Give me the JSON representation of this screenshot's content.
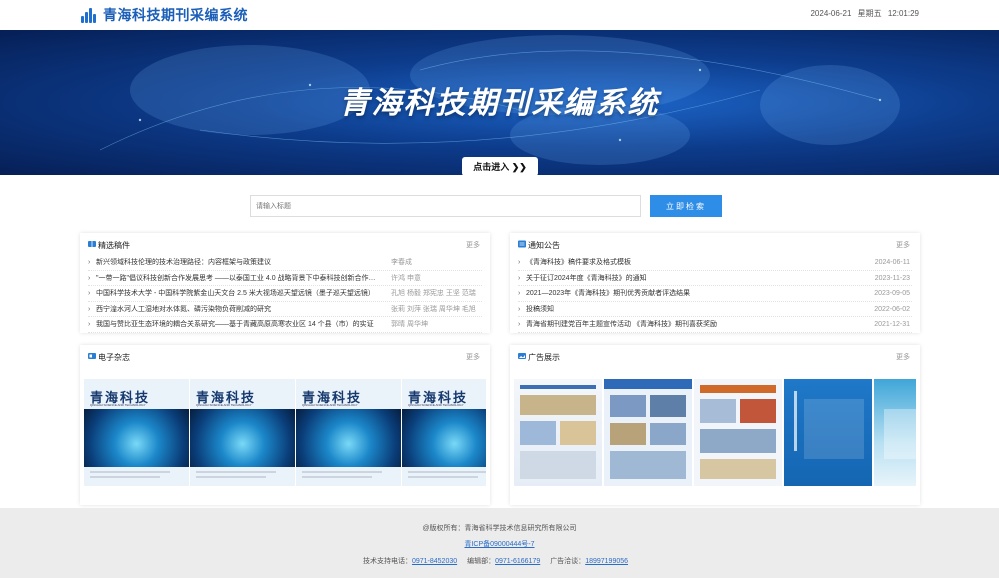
{
  "header": {
    "logo_text": "青海科技期刊采编系统",
    "date": "2024-06-21",
    "weekday": "星期五",
    "time": "12:01:29"
  },
  "banner": {
    "title": "青海科技期刊采编系统",
    "enter_label": "点击进入 ❯❯"
  },
  "search": {
    "placeholder": "请输入标题",
    "button_label": "立即检索"
  },
  "featured": {
    "title": "精选稿件",
    "more": "更多",
    "items": [
      {
        "title": "新兴领域科技伦理的技术治理路径：内容框架与政策建议",
        "authors": "李春成"
      },
      {
        "title": "\"一带一路\"倡议科技创新合作发展思考 ——以泰国工业 4.0 战略背景下中泰科技创新合作为例",
        "authors": "许鸿 申意"
      },
      {
        "title": "中国科学技术大学 - 中国科学院紫金山天文台 2.5 米大视场巡天望远镜（墨子巡天望远镜）",
        "authors": "孔旭 杨毅 郑宪忠 王坚 范瑞"
      },
      {
        "title": "西宁湟水河人工湿地对水体氮、磷污染物负荷削减的研究",
        "authors": "张莉 刘萍 张瑞 周华坤 毛旭"
      },
      {
        "title": "我国与赞比亚生态环境的耦合关系研究——基于青藏高原高寒农业区 14 个县（市）的实证",
        "authors": "郭晴 周华坤"
      }
    ]
  },
  "notices": {
    "title": "通知公告",
    "more": "更多",
    "items": [
      {
        "title": "《青海科技》稿件要求及格式模板",
        "date": "2024-06-11"
      },
      {
        "title": "关于征订2024年度《青海科技》的通知",
        "date": "2023-11-23"
      },
      {
        "title": "2021—2023年《青海科技》期刊优秀贡献者评选结果",
        "date": "2023-09-05"
      },
      {
        "title": "投稿须知",
        "date": "2022-06-02"
      },
      {
        "title": "青海省期刊建党百年主题宣传活动 《青海科技》期刊喜获奖励",
        "date": "2021-12-31"
      }
    ]
  },
  "magazine": {
    "title": "电子杂志",
    "more": "更多",
    "items": [
      {
        "name": "青海科技",
        "sub": "QINGHAI SCIENCE AND TECHNOLOGY"
      },
      {
        "name": "青海科技",
        "sub": "QINGHAI SCIENCE AND TECHNOLOGY"
      },
      {
        "name": "青海科技",
        "sub": "QINGHAI SCIENCE AND TECHNOLOGY"
      },
      {
        "name": "青海科技",
        "sub": "QINGHAI SCIENCE AND TECHNOLOGY"
      }
    ]
  },
  "ads": {
    "title": "广告展示",
    "more": "更多"
  },
  "footer": {
    "copyright": "@版权所有：青海省科学技术信息研究所有限公司",
    "icp": "青ICP备09000444号-7",
    "support_label": "技术支持电话：",
    "support_phone": "0971-8452030",
    "editorial_label": "编辑部：",
    "editorial_phone": "0971-6166179",
    "ad_label": "广告洽谈：",
    "ad_phone": "18997199056"
  },
  "colors": {
    "accent": "#2e8de6",
    "brand": "#1b5fb8",
    "banner_dark": "#061f56"
  }
}
